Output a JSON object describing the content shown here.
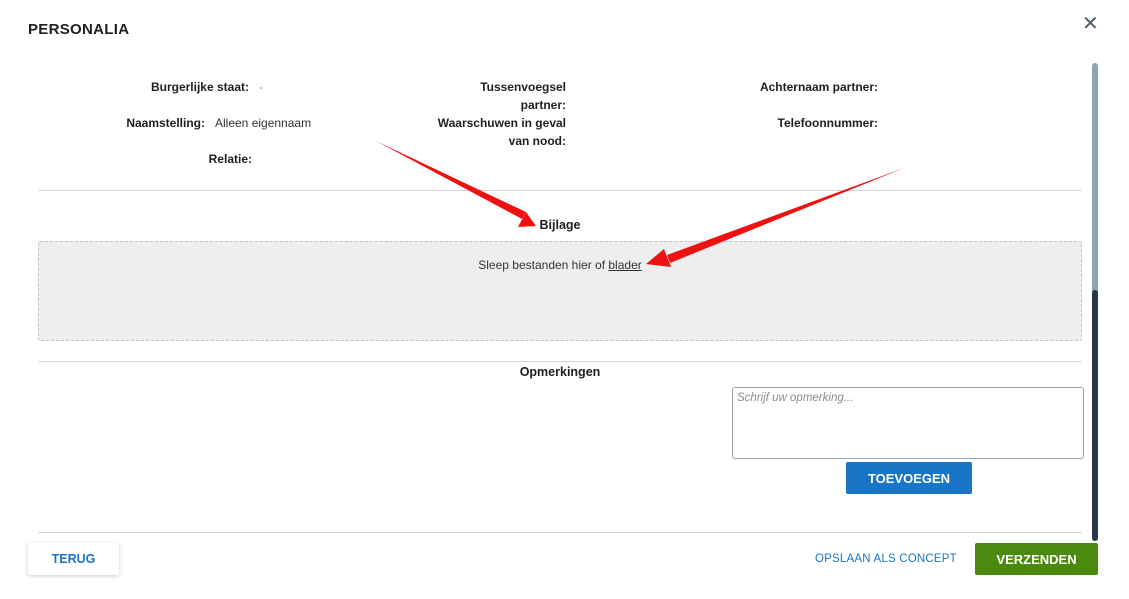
{
  "header": {
    "title": "PERSONALIA",
    "close_icon": "close-icon"
  },
  "details": {
    "burgerlijke_staat": {
      "label": "Burgerlijke staat:",
      "value": "-"
    },
    "naamstelling": {
      "label": "Naamstelling:",
      "value": "Alleen eigennaam"
    },
    "relatie": {
      "label": "Relatie:",
      "value": ""
    },
    "tussenvoegsel_partner": {
      "label_line1": "Tussenvoegsel",
      "label_line2": "partner:",
      "value": ""
    },
    "waarschuwen": {
      "label_line1": "Waarschuwen in geval",
      "label_line2": "van nood:",
      "value": ""
    },
    "achternaam_partner": {
      "label": "Achternaam partner:",
      "value": ""
    },
    "telefoonnummer": {
      "label": "Telefoonnummer:",
      "value": ""
    }
  },
  "bijlage": {
    "heading": "Bijlage",
    "drop_text": "Sleep bestanden hier of",
    "browse_link": "blader"
  },
  "opmerkingen": {
    "heading": "Opmerkingen",
    "placeholder": "Schrijf uw opmerking...",
    "add_button": "TOEVOEGEN"
  },
  "footer": {
    "back_button": "TERUG",
    "save_concept": "OPSLAAN ALS CONCEPT",
    "send_button": "VERZENDEN"
  },
  "colors": {
    "primary_blue": "#1b75c7",
    "send_green": "#4a8a0f",
    "annotation_red": "#ee1111"
  }
}
